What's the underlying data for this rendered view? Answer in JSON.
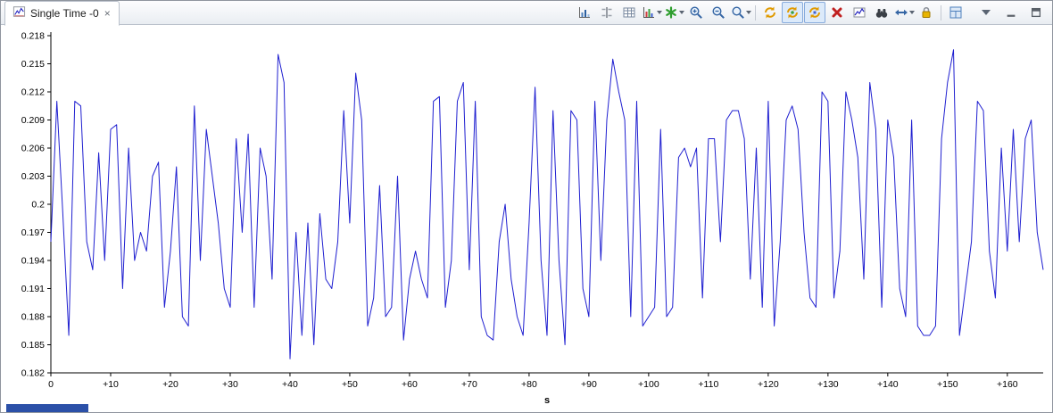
{
  "tab": {
    "label": "Single Time -0",
    "close_glyph": "×"
  },
  "toolbar": {
    "items": [
      {
        "name": "chart-properties-icon",
        "icon": "chart-bars"
      },
      {
        "name": "align-charts-icon",
        "icon": "align"
      },
      {
        "name": "show-grid-icon",
        "icon": "grid"
      },
      {
        "name": "chart-type-menu",
        "icon": "chart-colored",
        "dropdown": true
      },
      {
        "name": "new-series-menu",
        "icon": "star-green",
        "dropdown": true
      },
      {
        "name": "zoom-in-button",
        "icon": "zoom-in"
      },
      {
        "name": "zoom-out-button",
        "icon": "zoom-out"
      },
      {
        "name": "zoom-menu",
        "icon": "zoom",
        "dropdown": true
      },
      {
        "separator": true
      },
      {
        "name": "refresh-button",
        "icon": "refresh-yellow"
      },
      {
        "name": "auto-refresh-toggle",
        "icon": "refresh-yellow-dot",
        "pressed": true
      },
      {
        "name": "live-update-toggle",
        "icon": "refresh-yellow-box",
        "pressed": true
      },
      {
        "name": "remove-chart-button",
        "icon": "red-x"
      },
      {
        "name": "snapshot-button",
        "icon": "chart-small"
      },
      {
        "name": "search-button",
        "icon": "binoculars"
      },
      {
        "name": "pan-menu",
        "icon": "arrows",
        "dropdown": true
      },
      {
        "name": "lock-axes-button",
        "icon": "lock"
      },
      {
        "separator": true
      },
      {
        "name": "restore-layout-button",
        "icon": "layout"
      }
    ]
  },
  "chart_data": {
    "type": "line",
    "title": "",
    "xlabel": "s",
    "ylabel": "",
    "grid": false,
    "legend": "none",
    "xlim": [
      0,
      166
    ],
    "ylim": [
      0.182,
      0.218
    ],
    "x_tick_values": [
      0,
      10,
      20,
      30,
      40,
      50,
      60,
      70,
      80,
      90,
      100,
      110,
      120,
      130,
      140,
      150,
      160
    ],
    "x_tick_labels": [
      "0",
      "+10",
      "+20",
      "+30",
      "+40",
      "+50",
      "+60",
      "+70",
      "+80",
      "+90",
      "+100",
      "+110",
      "+120",
      "+130",
      "+140",
      "+150",
      "+160"
    ],
    "y_tick_values": [
      0.218,
      0.215,
      0.212,
      0.209,
      0.206,
      0.203,
      0.2,
      0.197,
      0.194,
      0.191,
      0.188,
      0.185,
      0.182
    ],
    "y_tick_labels": [
      "0.218",
      "0.215",
      "0.212",
      "0.209",
      "0.206",
      "0.203",
      "0.2",
      "0.197",
      "0.194",
      "0.191",
      "0.188",
      "0.185",
      "0.182"
    ],
    "x_start": 0,
    "x_step": 1,
    "series": [
      {
        "name": "Single Time -0",
        "color": "#1f1fd0",
        "values": [
          0.196,
          0.211,
          0.199,
          0.186,
          0.211,
          0.2105,
          0.196,
          0.193,
          0.2055,
          0.194,
          0.208,
          0.2085,
          0.191,
          0.206,
          0.194,
          0.197,
          0.195,
          0.203,
          0.2045,
          0.189,
          0.195,
          0.204,
          0.188,
          0.187,
          0.2105,
          0.194,
          0.208,
          0.203,
          0.198,
          0.191,
          0.189,
          0.207,
          0.197,
          0.2075,
          0.189,
          0.206,
          0.203,
          0.192,
          0.216,
          0.213,
          0.1835,
          0.197,
          0.186,
          0.198,
          0.185,
          0.199,
          0.192,
          0.191,
          0.196,
          0.21,
          0.198,
          0.214,
          0.209,
          0.187,
          0.19,
          0.202,
          0.188,
          0.189,
          0.203,
          0.1855,
          0.192,
          0.195,
          0.192,
          0.19,
          0.211,
          0.2115,
          0.189,
          0.194,
          0.211,
          0.213,
          0.193,
          0.211,
          0.188,
          0.186,
          0.1855,
          0.196,
          0.2,
          0.192,
          0.188,
          0.186,
          0.198,
          0.2125,
          0.194,
          0.186,
          0.21,
          0.194,
          0.185,
          0.21,
          0.209,
          0.191,
          0.188,
          0.211,
          0.194,
          0.209,
          0.2155,
          0.212,
          0.209,
          0.188,
          0.211,
          0.187,
          0.188,
          0.189,
          0.208,
          0.188,
          0.189,
          0.205,
          0.206,
          0.204,
          0.206,
          0.19,
          0.207,
          0.207,
          0.196,
          0.209,
          0.21,
          0.21,
          0.207,
          0.192,
          0.206,
          0.189,
          0.211,
          0.187,
          0.196,
          0.209,
          0.2105,
          0.208,
          0.197,
          0.19,
          0.189,
          0.212,
          0.211,
          0.19,
          0.195,
          0.212,
          0.209,
          0.205,
          0.192,
          0.213,
          0.208,
          0.189,
          0.209,
          0.205,
          0.191,
          0.188,
          0.209,
          0.187,
          0.186,
          0.186,
          0.187,
          0.207,
          0.213,
          0.2165,
          0.186,
          0.191,
          0.196,
          0.211,
          0.21,
          0.195,
          0.19,
          0.206,
          0.195,
          0.208,
          0.196,
          0.207,
          0.209,
          0.197,
          0.193
        ]
      }
    ]
  },
  "colors": {
    "line": "#1f1fd0",
    "axis": "#000000",
    "toolbar_pressed_bg": "#dceafa",
    "bottom_fragment": "#2b50a8"
  }
}
